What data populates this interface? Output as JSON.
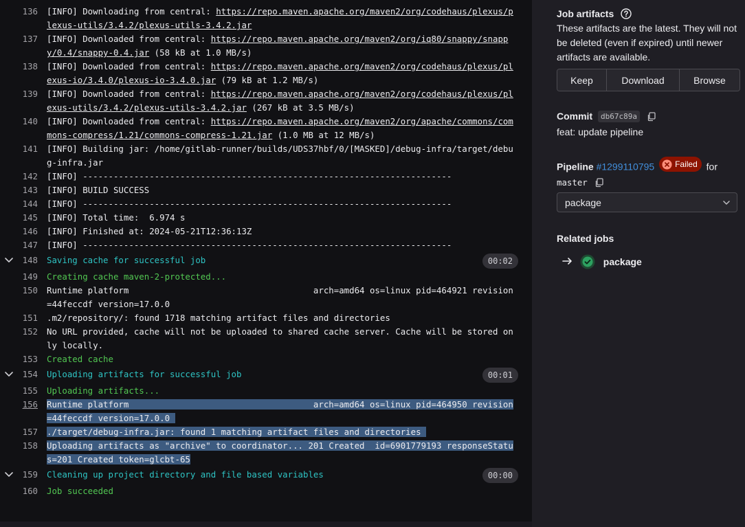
{
  "log": {
    "lines": [
      {
        "num": "136",
        "parts": [
          {
            "t": "[INFO] Downloading from central: "
          },
          {
            "t": "https://repo.maven.apache.org/maven2/org/codehaus/plexus/plexus-utils/3.4.2/plexus-utils-3.4.2.jar",
            "link": true
          }
        ]
      },
      {
        "num": "137",
        "parts": [
          {
            "t": "[INFO] Downloaded from central: "
          },
          {
            "t": "https://repo.maven.apache.org/maven2/org/iq80/snappy/snappy/0.4/snappy-0.4.jar",
            "link": true
          },
          {
            "t": " (58 kB at 1.0 MB/s)"
          }
        ]
      },
      {
        "num": "138",
        "parts": [
          {
            "t": "[INFO] Downloaded from central: "
          },
          {
            "t": "https://repo.maven.apache.org/maven2/org/codehaus/plexus/plexus-io/3.4.0/plexus-io-3.4.0.jar",
            "link": true
          },
          {
            "t": " (79 kB at 1.2 MB/s)"
          }
        ]
      },
      {
        "num": "139",
        "parts": [
          {
            "t": "[INFO] Downloaded from central: "
          },
          {
            "t": "https://repo.maven.apache.org/maven2/org/codehaus/plexus/plexus-utils/3.4.2/plexus-utils-3.4.2.jar",
            "link": true
          },
          {
            "t": " (267 kB at 3.5 MB/s)"
          }
        ]
      },
      {
        "num": "140",
        "parts": [
          {
            "t": "[INFO] Downloaded from central: "
          },
          {
            "t": "https://repo.maven.apache.org/maven2/org/apache/commons/commons-compress/1.21/commons-compress-1.21.jar",
            "link": true
          },
          {
            "t": " (1.0 MB at 12 MB/s)"
          }
        ]
      },
      {
        "num": "141",
        "parts": [
          {
            "t": "[INFO] Building jar: /home/gitlab-runner/builds/UDS37hbf/0/[MASKED]/debug-infra/target/debug-infra.jar"
          }
        ]
      },
      {
        "num": "142",
        "parts": [
          {
            "t": "[INFO] ------------------------------------------------------------------------"
          }
        ]
      },
      {
        "num": "143",
        "parts": [
          {
            "t": "[INFO] BUILD SUCCESS"
          }
        ]
      },
      {
        "num": "144",
        "parts": [
          {
            "t": "[INFO] ------------------------------------------------------------------------"
          }
        ]
      },
      {
        "num": "145",
        "parts": [
          {
            "t": "[INFO] Total time:  6.974 s"
          }
        ]
      },
      {
        "num": "146",
        "parts": [
          {
            "t": "[INFO] Finished at: 2024-05-21T12:36:13Z"
          }
        ]
      },
      {
        "num": "147",
        "parts": [
          {
            "t": "[INFO] ------------------------------------------------------------------------"
          }
        ]
      },
      {
        "num": "148",
        "section": true,
        "duration": "00:02",
        "parts": [
          {
            "t": "Saving cache for successful job",
            "color": "cyan"
          }
        ]
      },
      {
        "num": "149",
        "parts": [
          {
            "t": "Creating cache maven-2-protected...",
            "color": "green"
          }
        ]
      },
      {
        "num": "150",
        "parts": [
          {
            "t": "Runtime platform                                    arch=amd64 os=linux pid=464921 revision=44feccdf version=17.0.0"
          }
        ]
      },
      {
        "num": "151",
        "parts": [
          {
            "t": ".m2/repository/: found 1718 matching artifact files and directories"
          }
        ]
      },
      {
        "num": "152",
        "parts": [
          {
            "t": "No URL provided, cache will not be uploaded to shared cache server. Cache will be stored only locally."
          }
        ]
      },
      {
        "num": "153",
        "parts": [
          {
            "t": "Created cache",
            "color": "green"
          }
        ]
      },
      {
        "num": "154",
        "section": true,
        "duration": "00:01",
        "parts": [
          {
            "t": "Uploading artifacts for successful job",
            "color": "cyan"
          }
        ]
      },
      {
        "num": "155",
        "parts": [
          {
            "t": "Uploading artifacts...",
            "color": "green"
          }
        ]
      },
      {
        "num": "156",
        "underline": true,
        "parts": [
          {
            "t": "Runtime platform                                    arch=amd64 os=linux pid=464950 revision=44feccdf version=17.0.0 ",
            "sel": true
          }
        ]
      },
      {
        "num": "157",
        "parts": [
          {
            "t": "./target/debug-infra.jar: found 1 matching artifact files and directories ",
            "sel": true
          }
        ]
      },
      {
        "num": "158",
        "parts": [
          {
            "t": "Uploading artifacts as \"archive\" to coordinator... 201 Created  id=6901779193 responseStatus=201 Created token=glcbt-65",
            "sel": true
          }
        ]
      },
      {
        "num": "159",
        "section": true,
        "duration": "00:00",
        "parts": [
          {
            "t": "Cleaning up project directory and file based variables",
            "color": "cyan"
          }
        ]
      },
      {
        "num": "160",
        "parts": [
          {
            "t": "Job succeeded",
            "color": "green"
          }
        ]
      }
    ]
  },
  "sidebar": {
    "artifacts_title": "Job artifacts",
    "artifacts_desc": "These artifacts are the latest. They will not be deleted (even if expired) until newer artifacts are available.",
    "buttons": {
      "keep": "Keep",
      "download": "Download",
      "browse": "Browse"
    },
    "commit_label": "Commit",
    "commit_sha": "db67c89a",
    "commit_message": "feat: update pipeline",
    "pipeline_label": "Pipeline",
    "pipeline_id": "#1299110795",
    "pipeline_status": "Failed",
    "pipeline_for": "for",
    "pipeline_ref": "master",
    "stage": "package",
    "related_title": "Related jobs",
    "related_job": "package"
  },
  "colors": {
    "cyan": "#2ec3c3",
    "green": "#52c752",
    "link": "#428fdc",
    "failed_bg": "#8d1300",
    "success": "#2da160"
  }
}
